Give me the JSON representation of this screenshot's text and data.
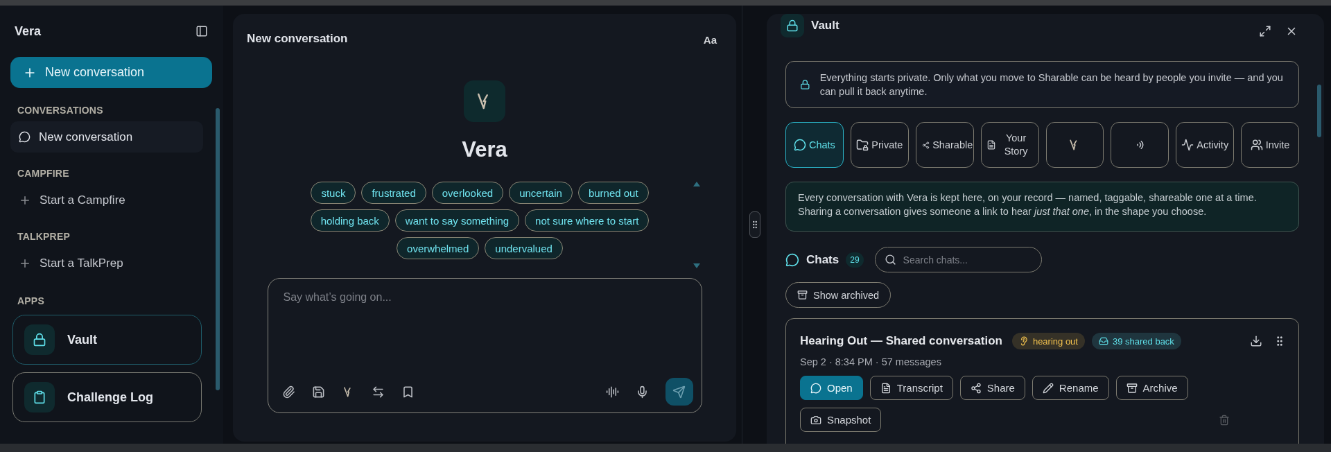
{
  "sidebar": {
    "title": "Vera",
    "new_button": "New conversation",
    "sections": [
      {
        "heading": "CONVERSATIONS",
        "items": [
          {
            "label": "New conversation",
            "kind": "chat",
            "selected": true
          }
        ]
      },
      {
        "heading": "CAMPFIRE",
        "items": [
          {
            "label": "Start a Campfire",
            "kind": "add",
            "selected": false
          }
        ]
      },
      {
        "heading": "TALKPREP",
        "items": [
          {
            "label": "Start a TalkPrep",
            "kind": "add",
            "selected": false
          }
        ]
      }
    ],
    "apps_heading": "APPS",
    "apps": [
      {
        "label": "Vault",
        "selected": true
      },
      {
        "label": "Challenge Log",
        "selected": false
      }
    ]
  },
  "conversation": {
    "title": "New conversation",
    "font_button": "Aa",
    "assistant_name": "Vera",
    "chips": [
      "stuck",
      "frustrated",
      "overlooked",
      "uncertain",
      "burned out",
      "holding back",
      "want to say something",
      "not sure where to start",
      "overwhelmed",
      "undervalued"
    ],
    "input": {
      "placeholder": "Say what’s going on..."
    }
  },
  "vault": {
    "title": "Vault",
    "notice": "Everything starts private. Only what you move to Sharable can be heard by people you invite — and you can pull it back anytime.",
    "tabs": [
      {
        "label": "Chats",
        "selected": true
      },
      {
        "label": "Private",
        "selected": false
      },
      {
        "label": "Sharable",
        "selected": false
      },
      {
        "label": "Your Story",
        "selected": false
      },
      {
        "selected": false
      },
      {
        "selected": false
      },
      {
        "label": "Activity",
        "selected": false
      },
      {
        "label": "Invite",
        "selected": false
      }
    ],
    "description": "Every conversation with Vera is kept here, on your record — named, taggable, shareable one at a time. Sharing a conversation gives someone a link to hear *just that one*, in the shape you choose.",
    "chats_heading": "Chats",
    "chats_count": "29",
    "search": {
      "placeholder": "Search chats..."
    },
    "show_archived": "Show archived",
    "card": {
      "title": "Hearing Out — Shared conversation",
      "tags": [
        {
          "label": "hearing out",
          "color": "#f2c14e"
        },
        {
          "label": "39 shared back",
          "color": "#5fdfe8"
        }
      ],
      "meta": "Sep 2 · 8:34 PM · 57 messages",
      "actions": [
        {
          "label": "Open",
          "kind": "primary"
        },
        {
          "label": "Transcript",
          "kind": "outline"
        },
        {
          "label": "Share",
          "kind": "outline"
        },
        {
          "label": "Rename",
          "kind": "outline"
        },
        {
          "label": "Archive",
          "kind": "outline"
        },
        {
          "label": "Snapshot",
          "kind": "outline"
        }
      ]
    }
  }
}
